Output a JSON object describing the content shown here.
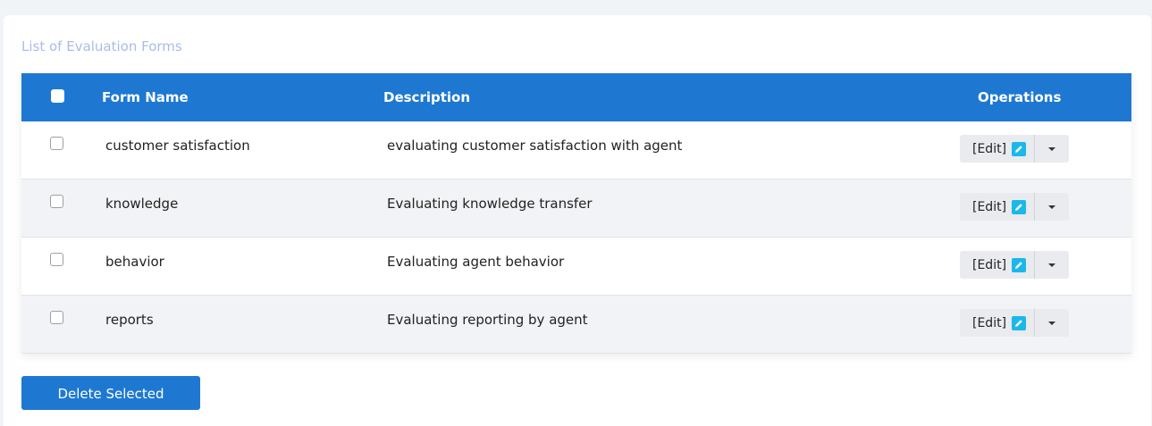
{
  "card": {
    "title": "List of Evaluation Forms"
  },
  "table": {
    "columns": [
      "Form Name",
      "Description",
      "Operations"
    ],
    "rows": [
      {
        "name": "customer satisfaction",
        "description": "evaluating customer satisfaction with agent",
        "edit_label": "[Edit]"
      },
      {
        "name": "knowledge",
        "description": "Evaluating knowledge transfer",
        "edit_label": "[Edit]"
      },
      {
        "name": "behavior",
        "description": "Evaluating agent behavior",
        "edit_label": "[Edit]"
      },
      {
        "name": "reports",
        "description": "Evaluating reporting by agent",
        "edit_label": "[Edit]"
      }
    ]
  },
  "actions": {
    "delete_label": "Delete Selected"
  },
  "colors": {
    "header_bg": "#1e78d2",
    "edit_icon": "#1bb8ea",
    "title": "#a9bde6"
  },
  "icons": {
    "edit": "pencil-icon",
    "dropdown": "caret-down-icon"
  }
}
